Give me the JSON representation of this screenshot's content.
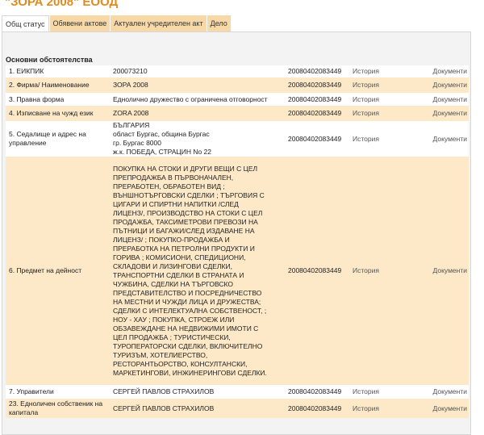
{
  "page_title": "\"ЗОРА 2008\" ЕООД",
  "tabs": [
    {
      "label": "Общ статус",
      "active": true
    },
    {
      "label": "Обявени актове",
      "active": false
    },
    {
      "label": "Актуален учредителен акт",
      "active": false
    },
    {
      "label": "Дело",
      "active": false
    }
  ],
  "section_title": "Основни обстоятелства",
  "rows": [
    {
      "label": "1.  ЕИКПИК",
      "value": [
        "200073210"
      ],
      "reg": "20080402083449",
      "history": "История",
      "docs": "Документи"
    },
    {
      "label": "2.  Фирма/ Наименование",
      "value": [
        "ЗОРА 2008"
      ],
      "reg": "20080402083449",
      "history": "История",
      "docs": "Документи"
    },
    {
      "label": "3.  Правна форма",
      "value": [
        "Еднолично дружество с ограничена отговорност"
      ],
      "reg": "20080402083449",
      "history": "История",
      "docs": "Документи"
    },
    {
      "label": "4.  Изписване на чужд език",
      "value": [
        "ZORA 2008"
      ],
      "reg": "20080402083449",
      "history": "История",
      "docs": "Документи"
    },
    {
      "label": "5.  Седалище и адрес на управление",
      "value": [
        "БЪЛГАРИЯ",
        "област Бургас, община Бургас",
        "гр. Бургас 8000",
        "ж.к. ПОБЕДА, СТРАЦИН No 22"
      ],
      "reg": "20080402083449",
      "history": "История",
      "docs": "Документи"
    },
    {
      "label": "6.  Предмет на дейност",
      "value": [
        "ПОКУПКА НА СТОКИ И ДРУГИ ВЕЩИ С ЦЕЛ",
        "ПРЕПРОДАЖБА В ПЪРВОНАЧАЛЕН,",
        "ПРЕРАБОТЕН, ОБРАБОТЕН ВИД ;",
        "ВЪНШНОТЪРГОВСКИ СДЕЛКИ ; ТЪРГОВИЯ С",
        "ЦИГАРИ И СПИРТНИ НАПИТКИ /СЛЕД",
        "ЛИЦЕНЗ/, ПРОИЗВОДСТВО НА СТОКИ С ЦЕЛ",
        "ПРОДАЖБА, ТАКСИМЕТРОВИ ПРЕВОЗИ НА",
        "ПЪТНИЦИ И БАГАЖИ/СЛЕД ИЗДАВАНЕ НА",
        "ЛИЦЕНЗ/ ; ПОКУПКО-ПРОДАЖБА И",
        "ПРЕРАБОТКА НА ПЕТРОЛНИ ПРОДУКТИ И",
        "ГОРИВА ; КОМИСИОНИ, СПЕДИЦИОНИ,",
        "СКЛАДОВИ И ЛИЗИНГОВИ СДЕЛКИ,",
        "ТРАНСПОРТНИ СДЕЛКИ В СТРАНАТА И",
        "ЧУЖБИНА, СДЕЛКИ НА ТЪРГОВСКО",
        "ПРЕДСТАВИТЕЛСТВО И ПОСРЕДНИЧЕСТВО",
        "НА МЕСТНИ И ЧУЖДИ ЛИЦА И ДРУЖЕСТВА;",
        "СДЕЛКИ С ИНТЕЛЕКТУАЛНА СОБСТВЕНОСТ, ;",
        "НОУ - ХАУ ; ПОКУПКА, СТРОЕЖ ИЛИ",
        "ОБЗАВЕЖДАНЕ НА НЕДВИЖИМИ ИМОТИ С",
        "ЦЕЛ ПРОДАЖБА ; ТУРИСТИЧЕСКИ,",
        "ТУРОПЕРАТОРСКИ СДЕЛКИ, ВКЛЮЧИТЕЛНО",
        "ТУРИЗЪМ, ХОТЕЛИЕРСТВО,",
        "РЕСТОРАНТЬОРСТВО, КОНСУЛТАНСКИ,",
        "МАРКЕТИНГОВИ, ИНЖИНЕРИНГОВИ СДЕЛКИ."
      ],
      "reg": "20080402083449",
      "history": "История",
      "docs": "Документи"
    },
    {
      "label": "7.  Управители",
      "value": [
        "СЕРГЕЙ ПАВЛОВ СТРАХИЛОВ"
      ],
      "reg": "20080402083449",
      "history": "История",
      "docs": "Документи"
    },
    {
      "label": "23.  Едноличен собственик на капитала",
      "value": [
        "СЕРГЕЙ ПАВЛОВ СТРАХИЛОВ"
      ],
      "reg": "20080402083449",
      "history": "История",
      "docs": "Документи"
    }
  ]
}
